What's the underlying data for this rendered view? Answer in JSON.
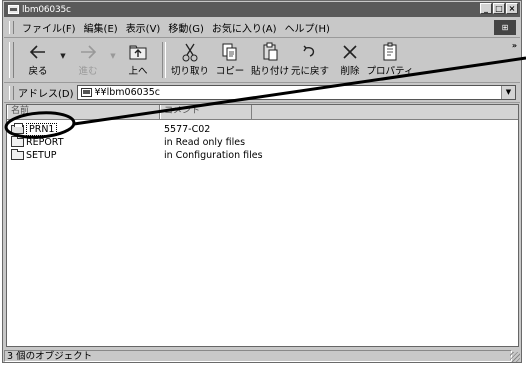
{
  "window": {
    "title": "lbm06035c",
    "min_label": "_",
    "max_label": "□",
    "close_label": "×"
  },
  "menu": {
    "items": [
      "ファイル(F)",
      "編集(E)",
      "表示(V)",
      "移動(G)",
      "お気に入り(A)",
      "ヘルプ(H)"
    ]
  },
  "toolbar": {
    "back": "戻る",
    "forward": "進む",
    "up": "上へ",
    "cut": "切り取り",
    "copy": "コピー",
    "paste": "貼り付け",
    "undo": "元に戻す",
    "delete": "削除",
    "properties": "プロパティ",
    "more": "»",
    "back_icon": "back-arrow-icon",
    "forward_icon": "forward-arrow-icon",
    "up_icon": "up-folder-icon",
    "cut_icon": "scissors-icon",
    "copy_icon": "copy-icon",
    "paste_icon": "paste-icon",
    "undo_icon": "undo-icon",
    "delete_icon": "delete-x-icon",
    "properties_icon": "properties-icon"
  },
  "address": {
    "label": "アドレス(D)",
    "value": "¥¥lbm06035c"
  },
  "list": {
    "columns": [
      "名前",
      "コメント"
    ],
    "rows": [
      {
        "name": "PRN1",
        "comment": "5577-C02",
        "icon": "printer-icon",
        "selected": true
      },
      {
        "name": "REPORT",
        "comment": "in Read only files",
        "icon": "folder-icon",
        "selected": false
      },
      {
        "name": "SETUP",
        "comment": "in Configuration files",
        "icon": "folder-icon",
        "selected": false
      }
    ]
  },
  "status": {
    "text": "3 個のオブジェクト"
  },
  "colors": {
    "titlebar": "#5a5a5a",
    "window_face": "#c8c8c8",
    "list_bg": "#ffffff"
  }
}
